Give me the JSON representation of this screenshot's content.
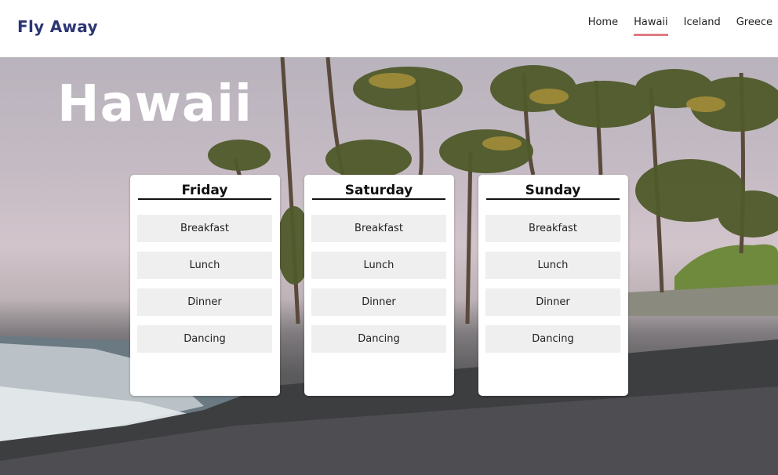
{
  "brand": "Fly Away",
  "nav": [
    {
      "label": "Home",
      "active": false
    },
    {
      "label": "Hawaii",
      "active": true
    },
    {
      "label": "Iceland",
      "active": false
    },
    {
      "label": "Greece",
      "active": false
    }
  ],
  "hero": {
    "title": "Hawaii"
  },
  "days": [
    {
      "title": "Friday",
      "activities": [
        "Breakfast",
        "Lunch",
        "Dinner",
        "Dancing"
      ]
    },
    {
      "title": "Saturday",
      "activities": [
        "Breakfast",
        "Lunch",
        "Dinner",
        "Dancing"
      ]
    },
    {
      "title": "Sunday",
      "activities": [
        "Breakfast",
        "Lunch",
        "Dinner",
        "Dancing"
      ]
    }
  ],
  "colors": {
    "brand": "#2c3574",
    "active_underline": "#e07a82"
  }
}
